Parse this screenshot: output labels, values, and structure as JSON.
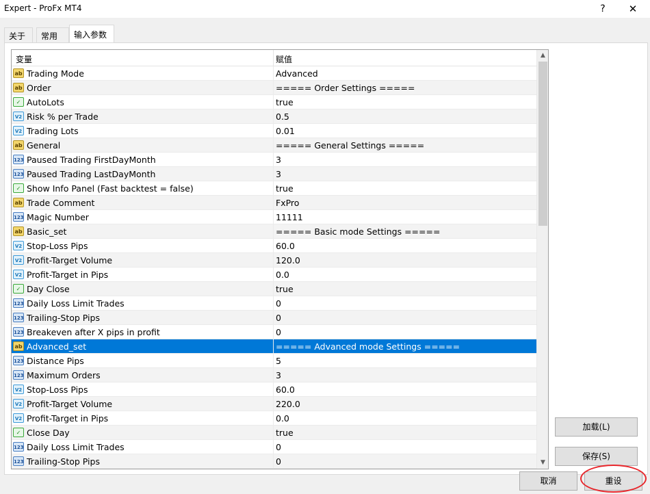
{
  "window": {
    "title": "Expert - ProFx MT4",
    "help": "?",
    "close": "✕"
  },
  "tabs": [
    {
      "label": "关于"
    },
    {
      "label": "常用"
    },
    {
      "label": "输入参数"
    }
  ],
  "grid": {
    "headers": {
      "variable": "变量",
      "value": "赋值"
    },
    "rows": [
      {
        "icon": "ab",
        "name": "Trading Mode",
        "value": "Advanced"
      },
      {
        "icon": "ab",
        "name": "Order",
        "value": "===== Order Settings ====="
      },
      {
        "icon": "bool",
        "name": "AutoLots",
        "value": "true"
      },
      {
        "icon": "dbl",
        "name": "Risk % per Trade",
        "value": "0.5"
      },
      {
        "icon": "dbl",
        "name": "Trading Lots",
        "value": "0.01"
      },
      {
        "icon": "ab",
        "name": "General",
        "value": "===== General Settings ====="
      },
      {
        "icon": "n123",
        "name": "Paused Trading FirstDayMonth",
        "value": "3"
      },
      {
        "icon": "n123",
        "name": "Paused Trading LastDayMonth",
        "value": "3"
      },
      {
        "icon": "bool",
        "name": "Show Info Panel (Fast backtest = false)",
        "value": "true"
      },
      {
        "icon": "ab",
        "name": "Trade Comment",
        "value": "FxPro"
      },
      {
        "icon": "n123",
        "name": "Magic Number",
        "value": "11111"
      },
      {
        "icon": "ab",
        "name": "Basic_set",
        "value": "===== Basic mode Settings ====="
      },
      {
        "icon": "dbl",
        "name": "Stop-Loss Pips",
        "value": "60.0"
      },
      {
        "icon": "dbl",
        "name": "Profit-Target Volume",
        "value": "120.0"
      },
      {
        "icon": "dbl",
        "name": "Profit-Target in Pips",
        "value": "0.0"
      },
      {
        "icon": "bool",
        "name": "Day Close",
        "value": "true"
      },
      {
        "icon": "n123",
        "name": "Daily Loss Limit Trades",
        "value": "0"
      },
      {
        "icon": "n123",
        "name": "Trailing-Stop Pips",
        "value": "0"
      },
      {
        "icon": "n123",
        "name": "Breakeven after X pips in profit",
        "value": "0"
      },
      {
        "icon": "ab",
        "name": "Advanced_set",
        "value": "===== Advanced mode Settings =====",
        "selected": true
      },
      {
        "icon": "n123",
        "name": "Distance Pips",
        "value": "5"
      },
      {
        "icon": "n123",
        "name": "Maximum Orders",
        "value": "3"
      },
      {
        "icon": "dbl",
        "name": "Stop-Loss Pips",
        "value": "60.0"
      },
      {
        "icon": "dbl",
        "name": "Profit-Target Volume",
        "value": "220.0"
      },
      {
        "icon": "dbl",
        "name": "Profit-Target in Pips",
        "value": "0.0"
      },
      {
        "icon": "bool",
        "name": "Close Day",
        "value": "true"
      },
      {
        "icon": "n123",
        "name": "Daily Loss Limit Trades",
        "value": "0"
      },
      {
        "icon": "n123",
        "name": "Trailing-Stop Pips",
        "value": "0"
      }
    ]
  },
  "icon_glyphs": {
    "ab": "ab",
    "n123": "123",
    "dbl": "V2",
    "bool": "✓"
  },
  "buttons": {
    "load": "加载(L)",
    "save": "保存(S)",
    "cancel": "取消",
    "reset": "重设"
  },
  "colors": {
    "selection": "#0078d7",
    "annotation_circle": "#e8262b"
  }
}
